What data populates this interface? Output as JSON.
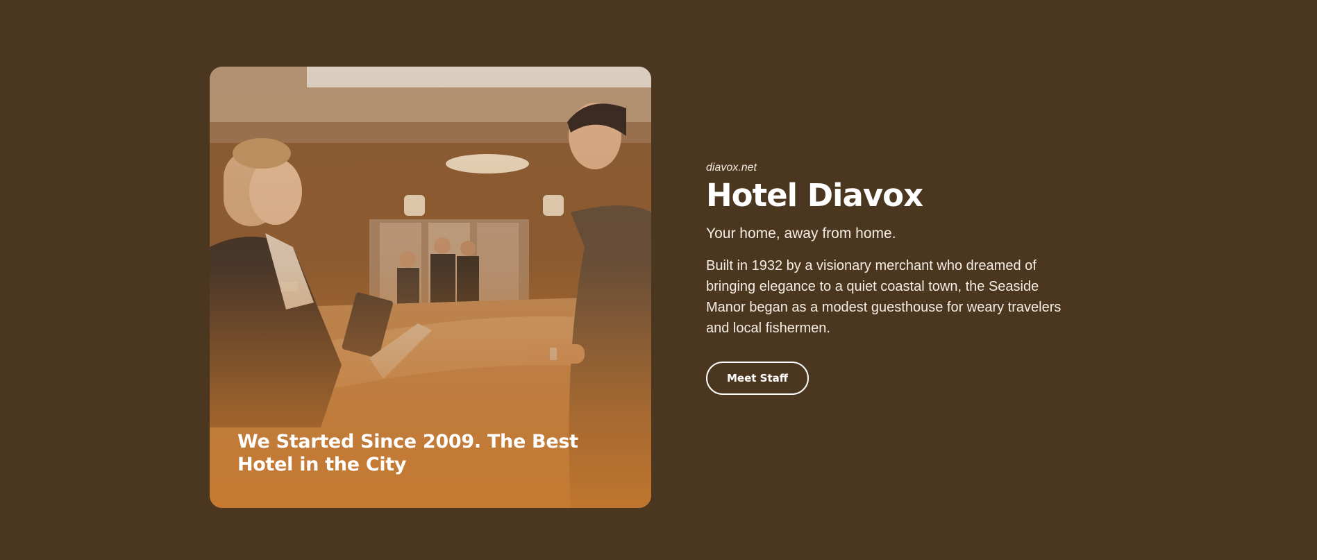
{
  "card": {
    "image_alt": "receptionist-greeting-guest-photo",
    "caption": "We Started Since 2009. The Best Hotel in the City"
  },
  "hero": {
    "site": "diavox.net",
    "title": "Hotel Diavox",
    "tagline": "Your home, away from home.",
    "description": "Built in 1932 by a visionary merchant who dreamed of bringing elegance to a quiet coastal town, the Seaside Manor began as a modest guesthouse for weary travelers and local fishermen.",
    "button_label": "Meet Staff"
  },
  "colors": {
    "background": "#4b3720",
    "accent": "#c5782d",
    "text": "#ffffff"
  }
}
